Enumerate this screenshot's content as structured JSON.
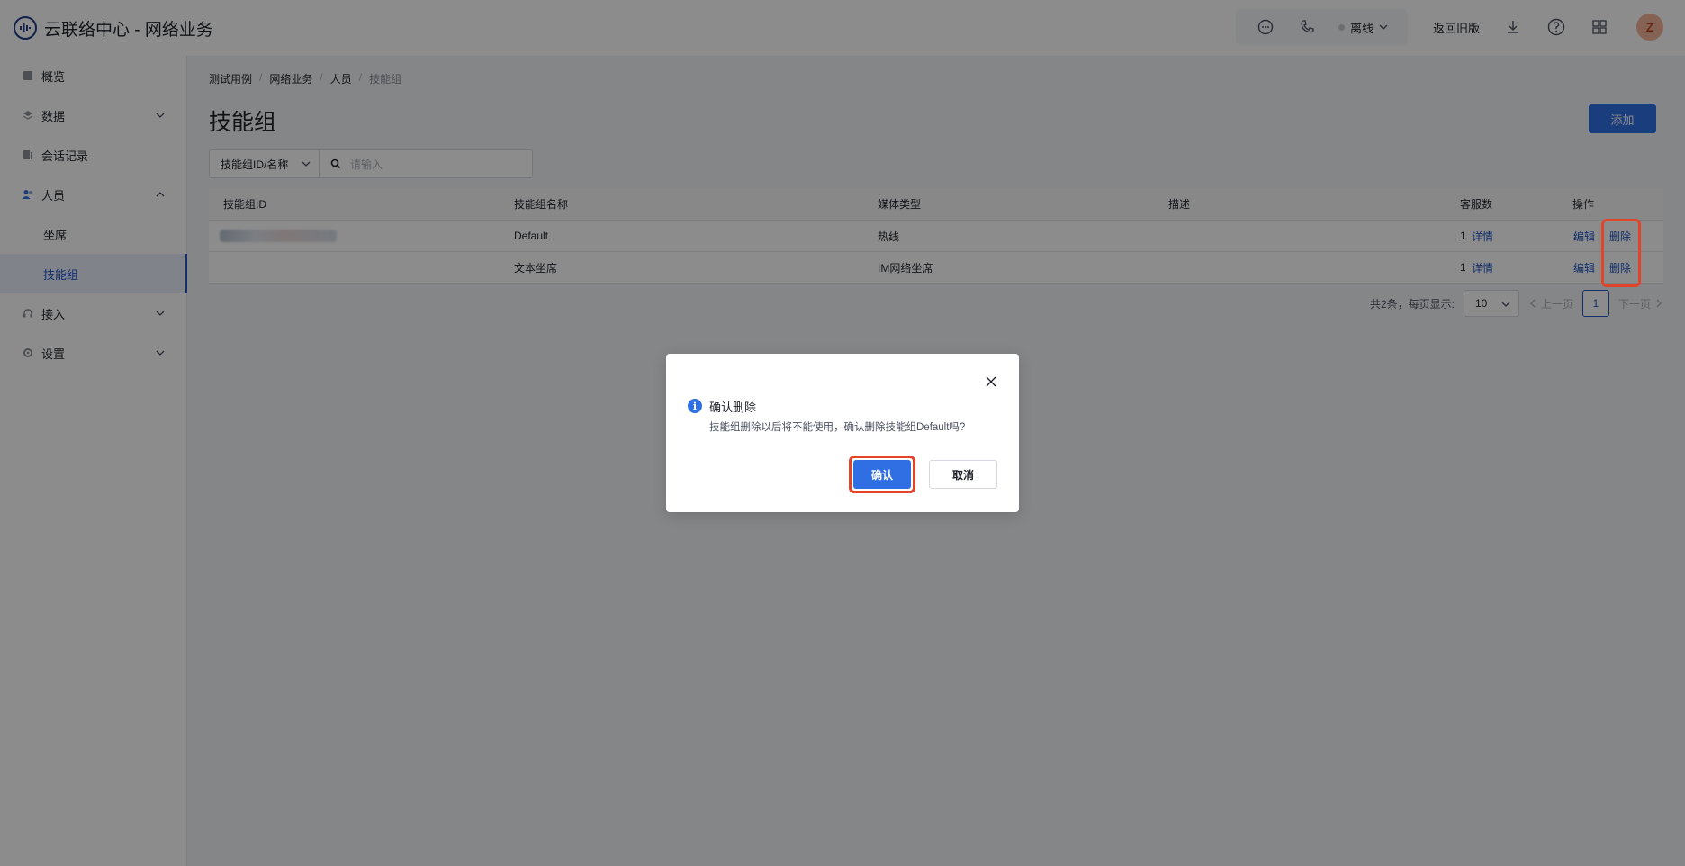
{
  "app": {
    "title": "云联络中心 - 网络业务"
  },
  "header": {
    "status_label": "离线",
    "back_old_label": "返回旧版",
    "avatar_text": "Z"
  },
  "sidebar": {
    "items": [
      {
        "label": "概览"
      },
      {
        "label": "数据"
      },
      {
        "label": "会话记录"
      },
      {
        "label": "人员"
      },
      {
        "label": "坐席"
      },
      {
        "label": "技能组"
      },
      {
        "label": "接入"
      },
      {
        "label": "设置"
      }
    ]
  },
  "breadcrumb": [
    "测试用例",
    "网络业务",
    "人员",
    "技能组"
  ],
  "page": {
    "title": "技能组",
    "add_label": "添加"
  },
  "filter": {
    "select_value": "技能组ID/名称",
    "placeholder": "请输入"
  },
  "table": {
    "headers": [
      "技能组ID",
      "技能组名称",
      "媒体类型",
      "描述",
      "客服数",
      "操作"
    ],
    "rows": [
      {
        "name": "Default",
        "media": "热线",
        "desc": "",
        "count": "1",
        "detail": "详情",
        "edit": "编辑",
        "delete": "删除"
      },
      {
        "name": "文本坐席",
        "media": "IM网络坐席",
        "desc": "",
        "count": "1",
        "detail": "详情",
        "edit": "编辑",
        "delete": "删除"
      }
    ]
  },
  "pagination": {
    "summary": "共2条，每页显示:",
    "page_size": "10",
    "prev_label": "上一页",
    "current_page": "1",
    "next_label": "下一页"
  },
  "dialog": {
    "title": "确认删除",
    "message": "技能组删除以后将不能使用，确认删除技能组Default吗?",
    "confirm_label": "确认",
    "cancel_label": "取消"
  },
  "colors": {
    "primary": "#2f6fe3",
    "highlight_ring": "#e0452b",
    "link": "#1f55c4"
  }
}
